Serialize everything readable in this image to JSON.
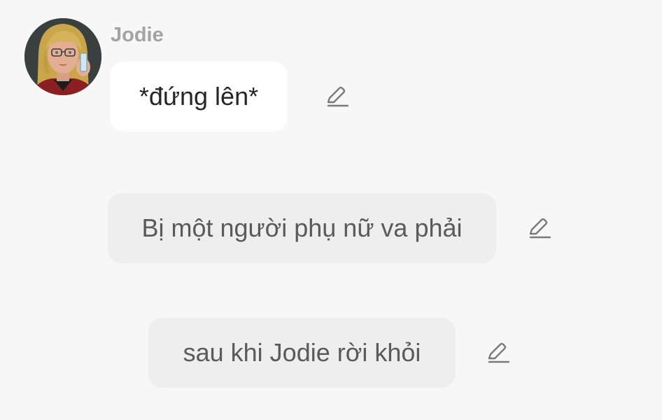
{
  "message_group": {
    "sender_name": "Jodie",
    "avatar_icon": "character-portrait"
  },
  "messages": [
    {
      "type": "dialogue",
      "text": "*đứng lên*",
      "edit_icon": "pencil-edit-icon"
    },
    {
      "type": "narration",
      "text": "Bị một người phụ nữ va phải",
      "edit_icon": "pencil-edit-icon"
    },
    {
      "type": "narration",
      "text": "sau khi Jodie rời khỏi",
      "edit_icon": "pencil-edit-icon"
    }
  ],
  "colors": {
    "background": "#f7f7f7",
    "dialogue_bubble": "#ffffff",
    "narration_bubble": "#eeeeee",
    "sender_name": "#a3a3a3",
    "icon": "#7a7a7a"
  }
}
